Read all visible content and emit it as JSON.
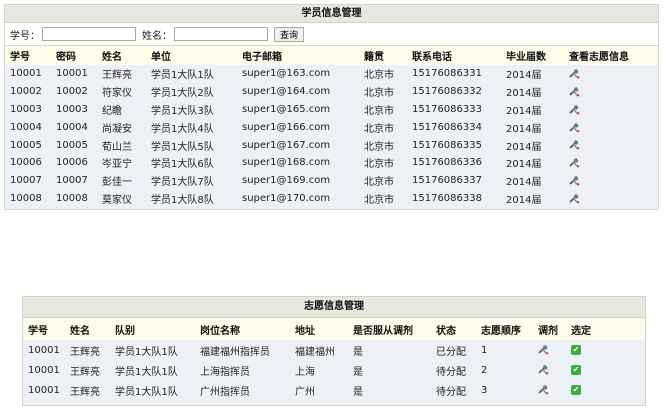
{
  "student_panel": {
    "title": "学员信息管理",
    "search": {
      "id_label": "学号：",
      "id_value": "",
      "name_label": "姓名：",
      "name_value": "",
      "button_label": "查询"
    },
    "columns": [
      "学号",
      "密码",
      "姓名",
      "单位",
      "电子邮箱",
      "籍贯",
      "联系电话",
      "毕业届数",
      "查看志愿信息"
    ],
    "rows": [
      [
        "10001",
        "10001",
        "王辉亮",
        "学员1大队1队",
        "super1@163.com",
        "北京市",
        "15176086331",
        "2014届"
      ],
      [
        "10002",
        "10002",
        "符家仪",
        "学员1大队2队",
        "super1@164.com",
        "北京市",
        "15176086332",
        "2014届"
      ],
      [
        "10003",
        "10003",
        "纪瞻",
        "学员1大队3队",
        "super1@165.com",
        "北京市",
        "15176086333",
        "2014届"
      ],
      [
        "10004",
        "10004",
        "尚凝安",
        "学员1大队4队",
        "super1@166.com",
        "北京市",
        "15176086334",
        "2014届"
      ],
      [
        "10005",
        "10005",
        "荀山兰",
        "学员1大队5队",
        "super1@167.com",
        "北京市",
        "15176086335",
        "2014届"
      ],
      [
        "10006",
        "10006",
        "岑亚宁",
        "学员1大队6队",
        "super1@168.com",
        "北京市",
        "15176086336",
        "2014届"
      ],
      [
        "10007",
        "10007",
        "彭佳一",
        "学员1大队7队",
        "super1@169.com",
        "北京市",
        "15176086337",
        "2014届"
      ],
      [
        "10008",
        "10008",
        "莫家仪",
        "学员1大队8队",
        "super1@170.com",
        "北京市",
        "15176086338",
        "2014届"
      ]
    ]
  },
  "volunteer_panel": {
    "title": "志愿信息管理",
    "columns": [
      "学号",
      "姓名",
      "队别",
      "岗位名称",
      "地址",
      "是否服从调剂",
      "状态",
      "志愿顺序",
      "调剂",
      "选定"
    ],
    "rows": [
      [
        "10001",
        "王辉亮",
        "学员1大队1队",
        "福建福州指挥员",
        "福建福州",
        "是",
        "已分配",
        "1"
      ],
      [
        "10001",
        "王辉亮",
        "学员1大队1队",
        "上海指挥员",
        "上海",
        "是",
        "待分配",
        "2"
      ],
      [
        "10001",
        "王辉亮",
        "学员1大队1队",
        "广州指挥员",
        "广州",
        "是",
        "待分配",
        "3"
      ]
    ]
  },
  "icons": {
    "view": "tools-icon",
    "adjust": "tools-icon",
    "select": "checkmark-icon"
  },
  "colors": {
    "header_bg": "#fdfbea",
    "row_bg": "#eef0f8",
    "title_bg": "#e8e8e0",
    "check_green": "#3caa3c"
  }
}
